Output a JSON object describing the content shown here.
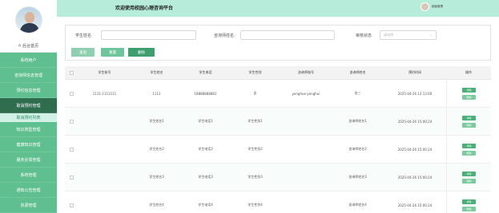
{
  "colors": {
    "sidebar": "#5fbf8e",
    "active": "#2f6d4e",
    "header": "#b6ecd9",
    "btn_query": "#8fcfb0",
    "btn_reset": "#6ec49b",
    "btn_delete": "#3f9e6d"
  },
  "header": {
    "title": "欢迎使用校园心理咨询平台",
    "username": "超级管理"
  },
  "sidebar": {
    "home": "后台首页",
    "items": [
      {
        "label": "系统用户"
      },
      {
        "label": "咨询师信息管理"
      },
      {
        "label": "预约信息管理"
      },
      {
        "label": "取消预约管理",
        "active": true
      },
      {
        "label": "取消预约列表",
        "sub": true
      },
      {
        "label": "知识类型管理"
      },
      {
        "label": "健康知识管理"
      },
      {
        "label": "服务反馈管理"
      },
      {
        "label": "系统管理"
      },
      {
        "label": "通知公告管理"
      },
      {
        "label": "资源管理"
      }
    ]
  },
  "search": {
    "student_name_label": "学生姓名",
    "counselor_name_label": "咨询师姓名",
    "review_status_label": "审核状态",
    "review_status_placeholder": "请选择",
    "query_label": "查询",
    "reset_label": "重置",
    "delete_label": "删除"
  },
  "table": {
    "columns": [
      "学生账号",
      "学生姓名",
      "学生电话",
      "学生性别",
      "咨询师账号",
      "咨询师姓名",
      "预约时间",
      "操作"
    ],
    "detail_label": "详情",
    "delete_label": "删除",
    "rows": [
      [
        "1111-1111111",
        "1111",
        "18888888881",
        "女",
        "yonghue-yonghui",
        "张三",
        "2025-04-26 12:13:00"
      ],
      [
        "",
        "学生姓名1",
        "学生电话1",
        "学生性别1",
        "",
        "咨询师姓名1",
        "2025-04-26 15:00:24"
      ],
      [
        "",
        "学生姓名2",
        "学生电话2",
        "学生性别2",
        "",
        "咨询师姓名2",
        "2025-04-26 15:00:24"
      ],
      [
        "",
        "学生姓名3",
        "学生电话3",
        "学生性别3",
        "",
        "咨询师姓名3",
        "2025-04-26 15:00:24"
      ],
      [
        "",
        "学生姓名4",
        "学生电话4",
        "学生性别4",
        "",
        "咨询师姓名4",
        "2025-04-26 15:00:24"
      ]
    ]
  }
}
